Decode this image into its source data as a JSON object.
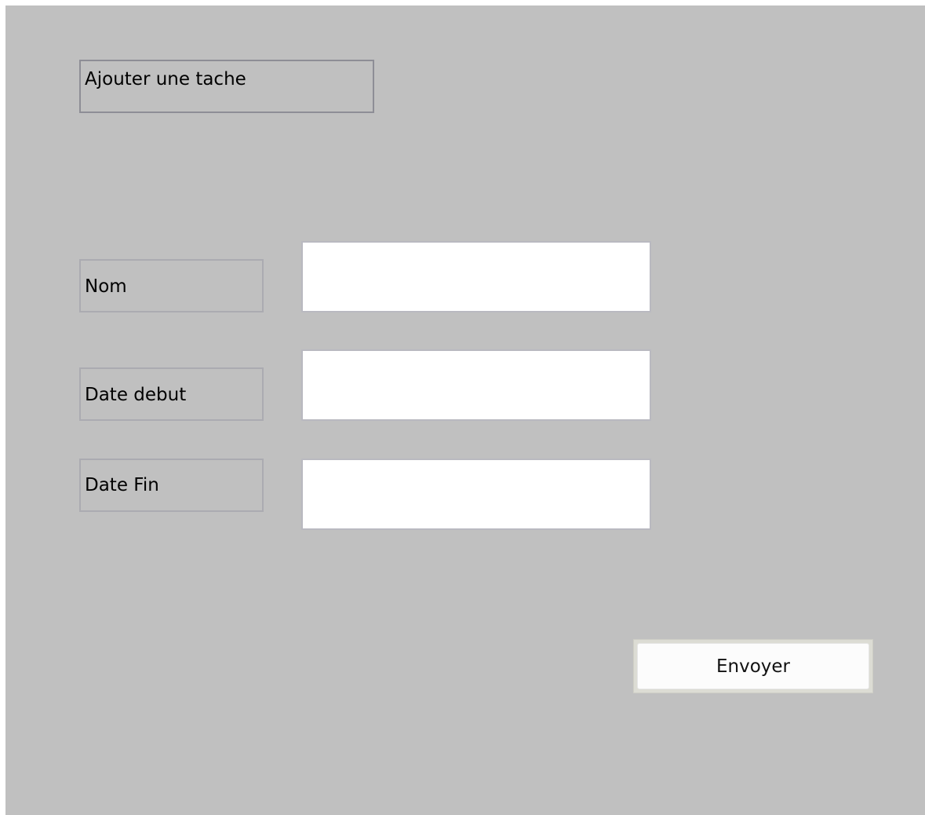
{
  "form": {
    "title": "Ajouter une tache",
    "fields": [
      {
        "label": "Nom",
        "value": "",
        "placeholder": ""
      },
      {
        "label": "Date debut",
        "value": "",
        "placeholder": ""
      },
      {
        "label": "Date Fin",
        "value": "",
        "placeholder": ""
      }
    ],
    "submit_label": "Envoyer"
  },
  "colors": {
    "panel_background": "#c0c0c0",
    "input_background": "#ffffff",
    "button_background": "#fcfcfc"
  }
}
